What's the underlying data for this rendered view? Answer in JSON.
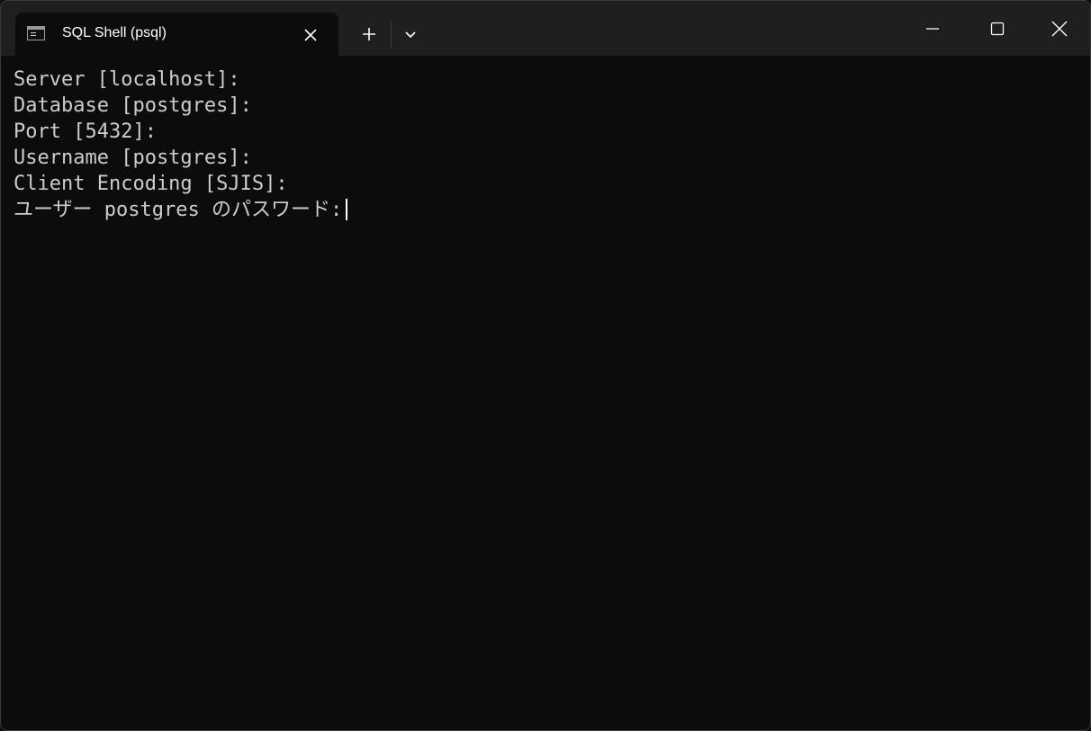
{
  "window": {
    "tab_title": "SQL Shell (psql)",
    "tab_icon": "terminal-icon",
    "buttons": {
      "new_tab_icon": "plus-icon",
      "dropdown_icon": "chevron-down-icon",
      "minimize_icon": "minimize-icon",
      "maximize_icon": "maximize-icon",
      "close_icon": "close-icon"
    }
  },
  "terminal": {
    "lines": [
      "Server [localhost]:",
      "Database [postgres]:",
      "Port [5432]:",
      "Username [postgres]:",
      "Client Encoding [SJIS]:",
      "ユーザー postgres のパスワード:"
    ],
    "foreground": "#cccccc",
    "background": "#0c0c0c"
  }
}
